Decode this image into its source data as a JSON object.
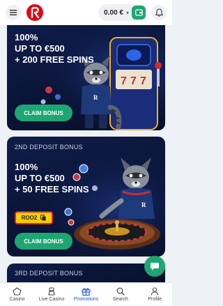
{
  "header": {
    "balance": "0.00 €",
    "colors": {
      "brand": "#e30613",
      "accent": "#1ea672"
    }
  },
  "promos": [
    {
      "label": "",
      "headline_line1": "100%",
      "headline_line2": "UP TO €500",
      "headline_line3": "+ 200 FREE SPINS",
      "button": "CLAIM BONUS"
    },
    {
      "label": "2ND DEPOSIT BONUS",
      "headline_line1": "100%",
      "headline_line2": "UP TO €500",
      "headline_line3": "+ 50 FREE SPINS",
      "promo_code": "ROO2",
      "button": "CLAIM BONUS"
    },
    {
      "label": "3RD DEPOSIT BONUS"
    }
  ],
  "bottom_nav": [
    {
      "label": "Casino",
      "icon": "casino-icon"
    },
    {
      "label": "Live Casino",
      "icon": "live-casino-icon"
    },
    {
      "label": "Promotions",
      "icon": "gift-icon",
      "active": true
    },
    {
      "label": "Search",
      "icon": "search-icon"
    },
    {
      "label": "Profile",
      "icon": "profile-icon"
    }
  ]
}
